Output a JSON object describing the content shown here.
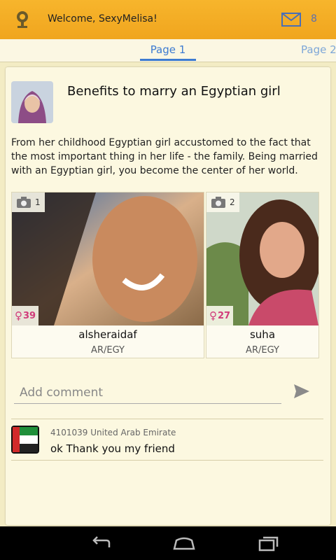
{
  "header": {
    "welcome": "Welcome, SexyMelisa!",
    "message_count": "8"
  },
  "tabs": [
    {
      "label": "Page 1"
    },
    {
      "label": "Page 2"
    }
  ],
  "post": {
    "title": "Benefits to marry an Egyptian girl",
    "body": "From her childhood Egyptian girl accustomed to the fact that the most important thing in her life - the family. Being married with an Egyptian girl, you become the center of her world."
  },
  "profiles": [
    {
      "photo_count": "1",
      "age": "39",
      "name": "alsheraidaf",
      "country": "AR/EGY"
    },
    {
      "photo_count": "2",
      "age": "27",
      "name": "suha",
      "country": "AR/EGY"
    }
  ],
  "comment_input": {
    "placeholder": "Add comment"
  },
  "comments": [
    {
      "meta": "4101039 United Arab Emirate",
      "text": "ok Thank you my friend"
    }
  ],
  "colors": {
    "accent": "#3d7bd1",
    "header": "#f7b52c",
    "female": "#d13b7a"
  }
}
